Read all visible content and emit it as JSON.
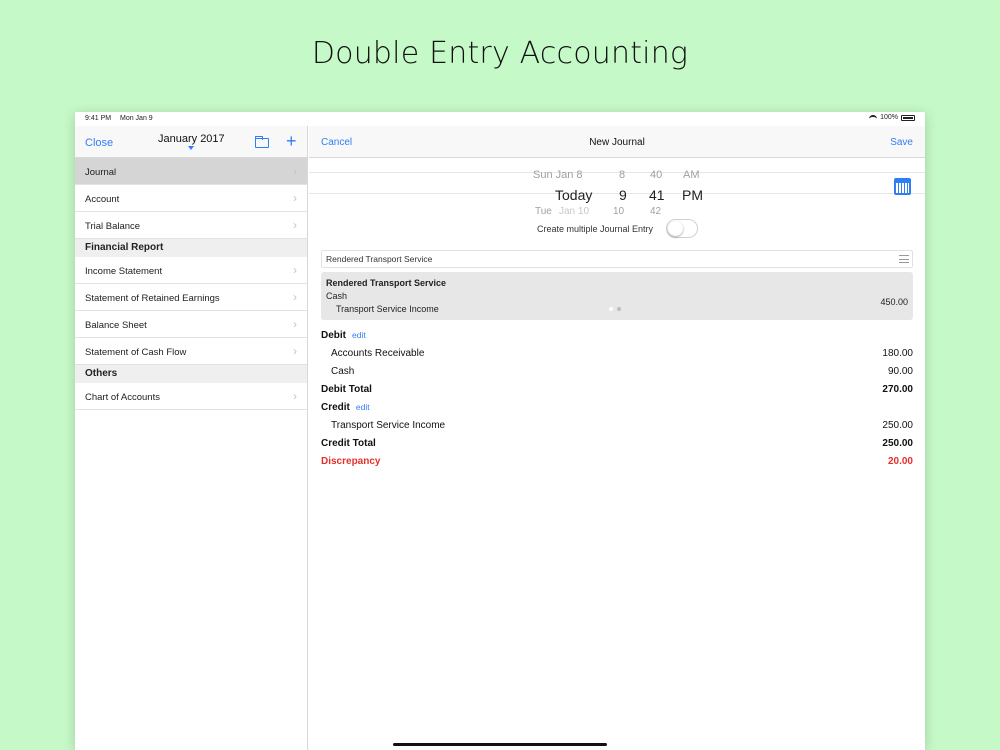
{
  "headline": "Double Entry Accounting",
  "status_bar": {
    "time": "9:41 PM",
    "date": "Mon Jan 9",
    "battery": "100%"
  },
  "sidebar": {
    "close_label": "Close",
    "title": "January 2017",
    "items": [
      {
        "label": "Journal",
        "selected": true
      },
      {
        "label": "Account"
      },
      {
        "label": "Trial Balance"
      }
    ],
    "section_financial": "Financial Report",
    "financial_items": [
      {
        "label": "Income Statement"
      },
      {
        "label": "Statement of Retained Earnings"
      },
      {
        "label": "Balance Sheet"
      },
      {
        "label": "Statement of Cash Flow"
      }
    ],
    "section_others": "Others",
    "others_items": [
      {
        "label": "Chart of Accounts"
      }
    ]
  },
  "main": {
    "cancel_label": "Cancel",
    "title": "New Journal",
    "save_label": "Save",
    "picker": {
      "prev": {
        "day": "Sun Jan 8",
        "hour": "8",
        "minute": "40",
        "ampm": "AM"
      },
      "current": {
        "day": "Today",
        "hour": "9",
        "minute": "41",
        "ampm": "PM"
      },
      "next": {
        "day_prefix": "Tue",
        "day_rest": "Jan 10",
        "hour": "10",
        "minute": "42"
      }
    },
    "toggle_label": "Create multiple Journal Entry",
    "description": "Rendered Transport Service",
    "preview": {
      "title": "Rendered Transport Service",
      "debit_account": "Cash",
      "credit_account": "Transport Service Income",
      "amount": "450.00"
    },
    "debit_label": "Debit",
    "edit_label": "edit",
    "debits": [
      {
        "account": "Accounts Receivable",
        "amount": "180.00"
      },
      {
        "account": "Cash",
        "amount": "90.00"
      }
    ],
    "debit_total_label": "Debit Total",
    "debit_total": "270.00",
    "credit_label": "Credit",
    "credits": [
      {
        "account": "Transport Service Income",
        "amount": "250.00"
      }
    ],
    "credit_total_label": "Credit Total",
    "credit_total": "250.00",
    "discrepancy_label": "Discrepancy",
    "discrepancy": "20.00"
  },
  "colors": {
    "background": "#c6f9c8",
    "accent": "#2f7ef7",
    "discrepancy": "#e5302a"
  },
  "icons": [
    "folder-icon",
    "plus-icon",
    "chevron-right-icon",
    "calendar-icon",
    "list-icon",
    "wifi-icon",
    "battery-icon"
  ]
}
